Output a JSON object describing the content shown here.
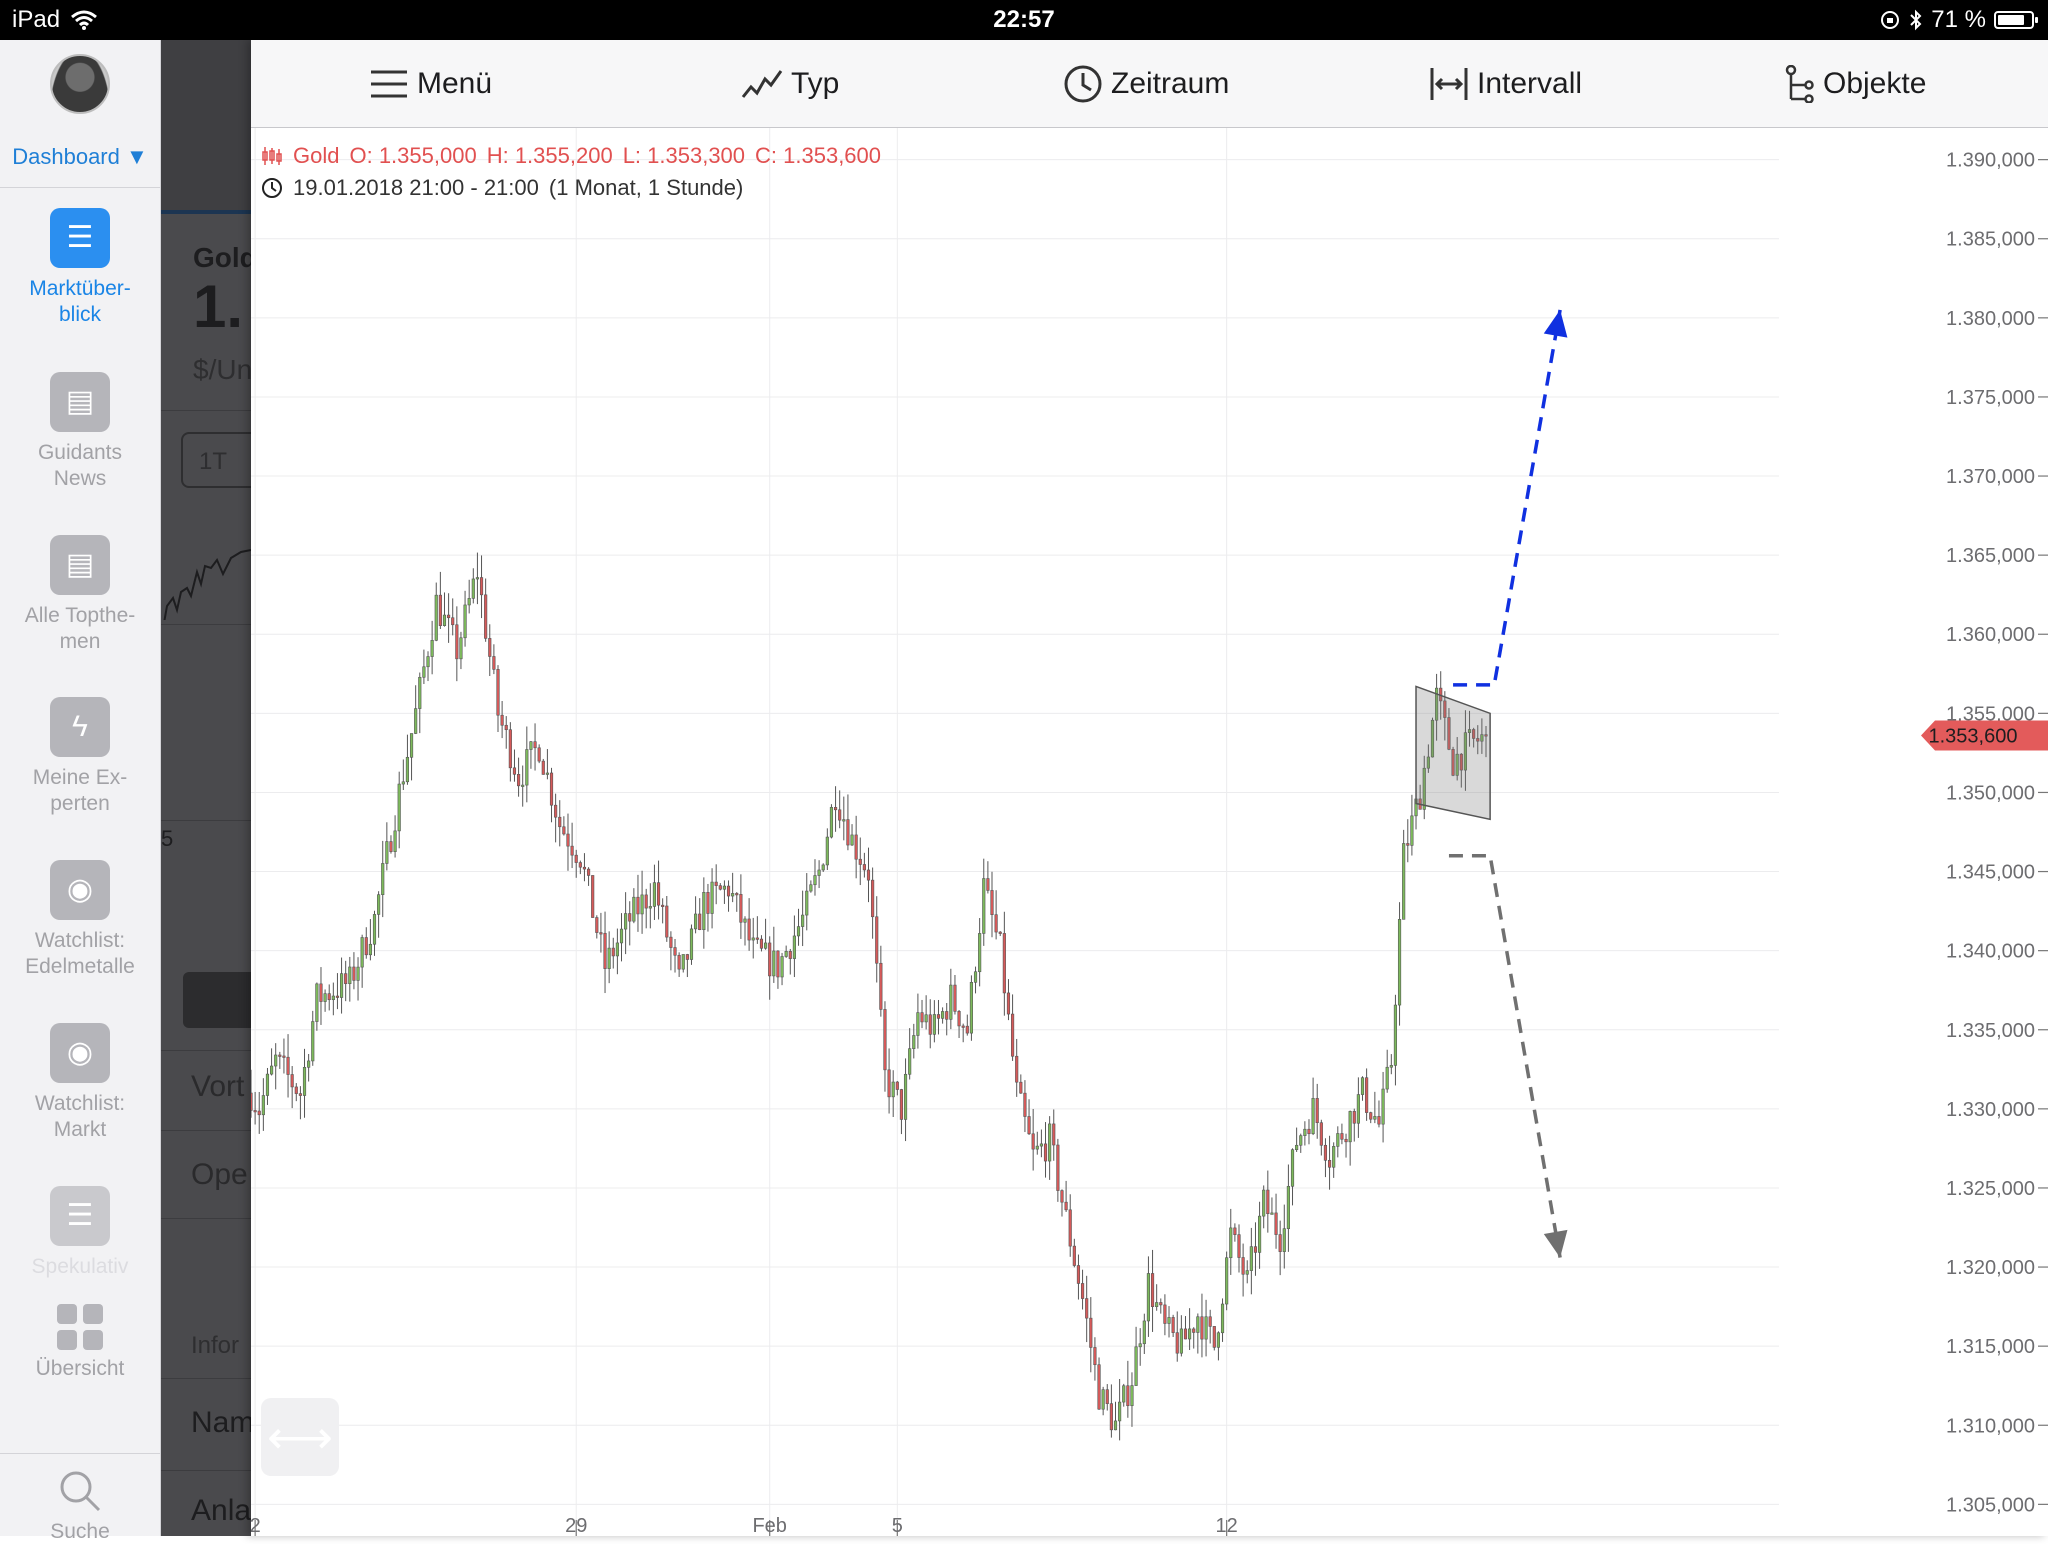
{
  "status_bar": {
    "device": "iPad",
    "time": "22:57",
    "battery": "71 %"
  },
  "sidebar": {
    "dashboard_label": "Dashboard ▼",
    "items": [
      {
        "label": "Marktüber-\nblick",
        "icon": "list-icon",
        "active": true
      },
      {
        "label": "Guidants\nNews",
        "icon": "news-icon"
      },
      {
        "label": "Alle Topthe-\nmen",
        "icon": "news-icon"
      },
      {
        "label": "Meine Ex-\nperten",
        "icon": "bolt-icon"
      },
      {
        "label": "Watchlist:\nEdelmetalle",
        "icon": "eye-icon"
      },
      {
        "label": "Watchlist:\nMarkt",
        "icon": "eye-icon"
      },
      {
        "label": "Spekulativ",
        "icon": "list-icon"
      },
      {
        "label": "Übersicht",
        "icon": "grid-icon"
      }
    ],
    "search_label": "Suche"
  },
  "background_panel": {
    "title": "Gold",
    "price": "1.",
    "unit": "$/Un",
    "range_button": "1T",
    "axis_fragment": "5",
    "row1": "Vort",
    "row2": "Ope",
    "section": "Infor",
    "row3": "Nam",
    "row4": "Anla"
  },
  "toolbar": {
    "menu": "Menü",
    "type": "Typ",
    "period": "Zeitraum",
    "interval": "Intervall",
    "objects": "Objekte"
  },
  "readout": {
    "instrument": "Gold",
    "open": "O: 1.355,000",
    "high": "H: 1.355,200",
    "low": "L: 1.353,300",
    "close": "C: 1.353,600",
    "range": "19.01.2018 21:00 - 21:00",
    "period": "(1 Monat, 1 Stunde)"
  },
  "chart_data": {
    "type": "candlestick",
    "instrument": "Gold",
    "y_ticks": [
      "1.390,000",
      "1.385,000",
      "1.380,000",
      "1.375,000",
      "1.370,000",
      "1.365,000",
      "1.360,000",
      "1.355,000",
      "1.350,000",
      "1.345,000",
      "1.340,000",
      "1.335,000",
      "1.330,000",
      "1.325,000",
      "1.320,000",
      "1.315,000",
      "1.310,000",
      "1.305,000"
    ],
    "ylim": [
      1303,
      1392
    ],
    "x_ticks": [
      "2",
      "29",
      "Feb",
      "5",
      "12"
    ],
    "current_price_label": "1.353,600",
    "current_price": 1353.6,
    "grid": true,
    "series_path_approx": [
      [
        0,
        1331
      ],
      [
        2,
        1330
      ],
      [
        6,
        1333
      ],
      [
        12,
        1331
      ],
      [
        16,
        1337
      ],
      [
        24,
        1338
      ],
      [
        30,
        1342
      ],
      [
        36,
        1350
      ],
      [
        40,
        1355
      ],
      [
        45,
        1362
      ],
      [
        50,
        1359
      ],
      [
        55,
        1364
      ],
      [
        60,
        1355
      ],
      [
        65,
        1351
      ],
      [
        70,
        1353
      ],
      [
        75,
        1348
      ],
      [
        80,
        1346
      ],
      [
        86,
        1339
      ],
      [
        92,
        1342
      ],
      [
        98,
        1344
      ],
      [
        104,
        1338
      ],
      [
        110,
        1343
      ],
      [
        116,
        1344
      ],
      [
        122,
        1340
      ],
      [
        128,
        1339
      ],
      [
        134,
        1342
      ],
      [
        138,
        1345
      ],
      [
        142,
        1350
      ],
      [
        146,
        1347
      ],
      [
        150,
        1345
      ],
      [
        154,
        1332
      ],
      [
        158,
        1330
      ],
      [
        162,
        1336
      ],
      [
        166,
        1335
      ],
      [
        170,
        1337
      ],
      [
        174,
        1335
      ],
      [
        178,
        1344
      ],
      [
        182,
        1340
      ],
      [
        186,
        1331
      ],
      [
        190,
        1327
      ],
      [
        194,
        1328
      ],
      [
        198,
        1323
      ],
      [
        202,
        1318
      ],
      [
        206,
        1312
      ],
      [
        210,
        1310
      ],
      [
        214,
        1313
      ],
      [
        218,
        1319
      ],
      [
        222,
        1316
      ],
      [
        226,
        1315
      ],
      [
        230,
        1317
      ],
      [
        234,
        1315
      ],
      [
        238,
        1322
      ],
      [
        242,
        1319
      ],
      [
        246,
        1324
      ],
      [
        250,
        1322
      ],
      [
        254,
        1328
      ],
      [
        258,
        1330
      ],
      [
        262,
        1327
      ],
      [
        266,
        1329
      ],
      [
        270,
        1331
      ],
      [
        274,
        1329
      ],
      [
        277,
        1333
      ],
      [
        280,
        1346
      ],
      [
        284,
        1350
      ],
      [
        288,
        1356
      ],
      [
        292,
        1352
      ],
      [
        296,
        1353
      ],
      [
        300,
        1353.6
      ]
    ],
    "x_tick_positions": [
      1,
      79,
      126,
      157,
      237,
      300
    ],
    "annotations": [
      {
        "type": "rectangle",
        "color": "gray",
        "x0": 283,
        "x1": 301,
        "y_left": [
          1356.7,
          1349.3
        ],
        "y_right": [
          1355.0,
          1348.3
        ]
      },
      {
        "type": "dashed-arrow",
        "color": "#1030e0",
        "points": [
          [
            292,
            1356.8
          ],
          [
            302,
            1356.8
          ],
          [
            318,
            1380.5
          ]
        ]
      },
      {
        "type": "dashed-arrow",
        "color": "#707070",
        "points": [
          [
            291,
            1346.0
          ],
          [
            301,
            1346.0
          ],
          [
            318,
            1320.6
          ]
        ]
      }
    ]
  }
}
